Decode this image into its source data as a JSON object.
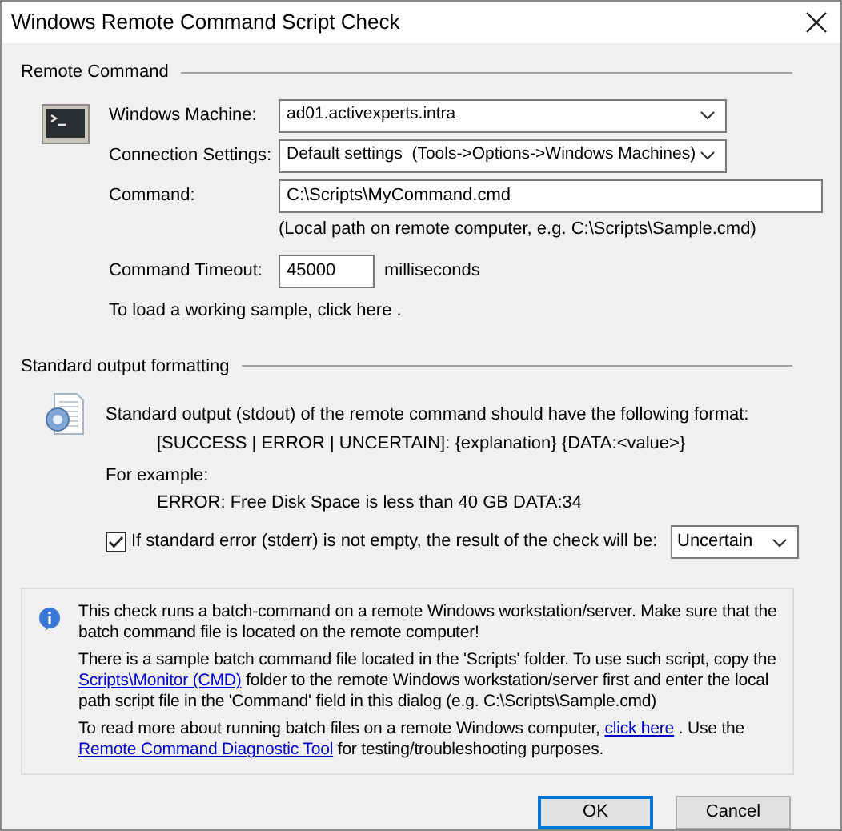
{
  "window": {
    "title": "Windows Remote Command Script Check"
  },
  "remote_command": {
    "heading": "Remote Command",
    "fields": [
      {
        "kind": "dropdown",
        "label": "Windows Machine:",
        "value": "ad01.activexperts.intra"
      },
      {
        "kind": "dropdown",
        "label": "Connection Settings:",
        "value": "Default settings  (Tools->Options->Windows Machines)"
      },
      {
        "kind": "text",
        "label": "Command:",
        "value": "C:\\Scripts\\MyCommand.cmd",
        "hint": "(Local path on remote computer, e.g. C:\\Scripts\\Sample.cmd)"
      },
      {
        "kind": "number",
        "label": "Command Timeout:",
        "value": "45000",
        "unit": "milliseconds"
      }
    ],
    "sample_link": "To load a working sample, click here ."
  },
  "output_formatting": {
    "heading": "Standard output formatting",
    "intro": "Standard output (stdout) of the remote command should have the following format:",
    "format": "[SUCCESS | ERROR | UNCERTAIN]: {explanation} {DATA:<value>}",
    "example_label": "For example:",
    "example": "ERROR: Free Disk Space is less than 40 GB DATA:34",
    "stderr_check": {
      "checked": true,
      "label": "If standard error (stderr) is not empty, the result of the check will be:",
      "result": "Uncertain"
    }
  },
  "info": {
    "paragraphs": [
      [
        {
          "text": "This check runs a batch-command on a remote Windows workstation/server. Make sure that the batch command file is located on the remote computer!"
        }
      ],
      [
        {
          "text": "There is a sample batch command file located in the 'Scripts' folder. To use such script, copy the "
        },
        {
          "text": "Scripts\\Monitor (CMD)",
          "link": true
        },
        {
          "text": " folder to the remote Windows workstation/server first and enter the local path script file in the 'Command' field in this dialog (e.g. C:\\Scripts\\Sample.cmd)"
        }
      ],
      [
        {
          "text": "To read more about running batch files on a remote Windows computer, "
        },
        {
          "text": "click here",
          "link": true
        },
        {
          "text": " . Use the "
        },
        {
          "text": "Remote Command Diagnostic Tool",
          "link": true
        },
        {
          "text": " for testing/troubleshooting purposes."
        }
      ]
    ]
  },
  "buttons": [
    {
      "label": "OK",
      "default": true
    },
    {
      "label": "Cancel",
      "default": false
    }
  ]
}
